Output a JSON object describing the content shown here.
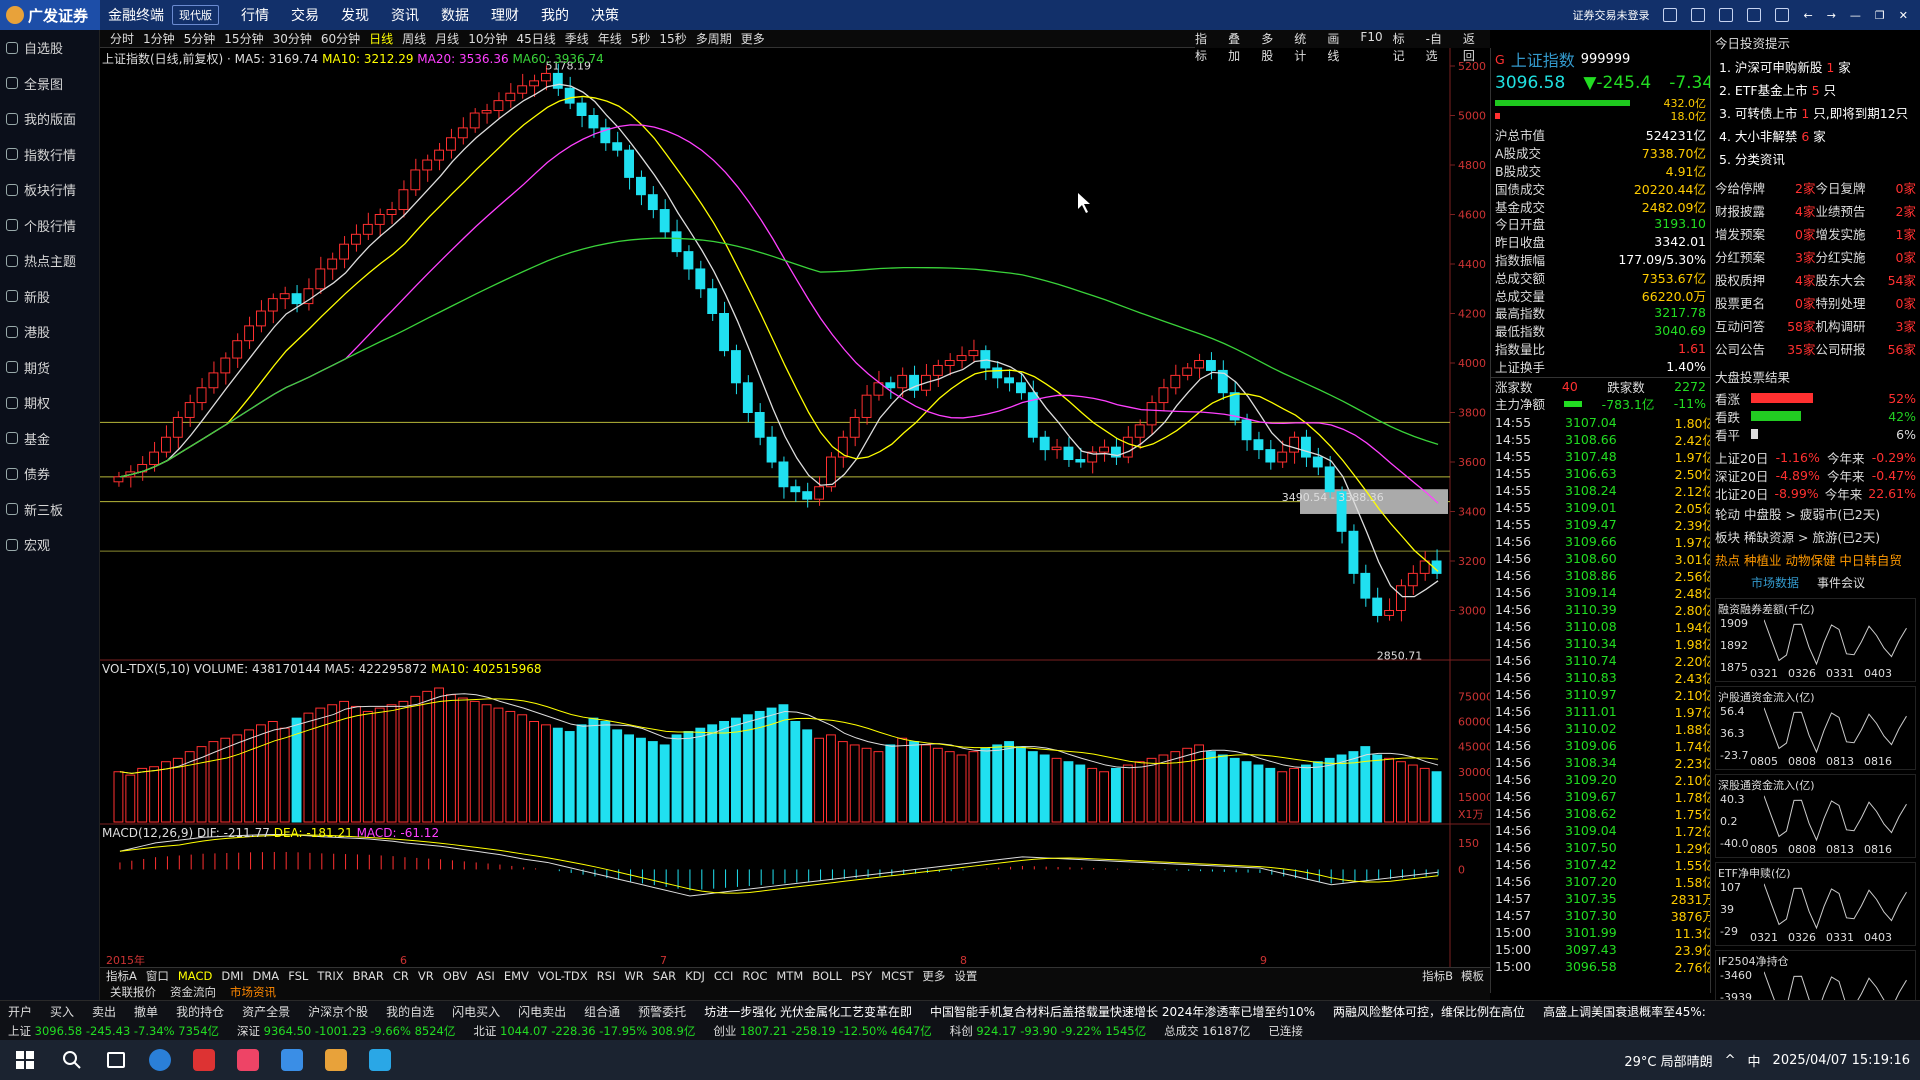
{
  "app": {
    "brand": "广发证券",
    "name": "金融终端",
    "mode": "现代版",
    "menu": [
      "行情",
      "交易",
      "发现",
      "资讯",
      "数据",
      "理财",
      "我的",
      "决策"
    ],
    "login_status": "证券交易未登录"
  },
  "sidebar": [
    "自选股",
    "全景图",
    "我的版面",
    "指数行情",
    "板块行情",
    "个股行情",
    "热点主题",
    "新股",
    "港股",
    "期货",
    "期权",
    "基金",
    "债券",
    "新三板",
    "宏观"
  ],
  "timeframes": [
    "分时",
    "1分钟",
    "5分钟",
    "15分钟",
    "30分钟",
    "60分钟",
    "日线",
    "周线",
    "月线",
    "10分钟",
    "45日线",
    "季线",
    "年线",
    "5秒",
    "15秒",
    "多周期",
    "更多"
  ],
  "timeframe_selected": "日线",
  "chart_tools": [
    "指标",
    "叠加",
    "多股",
    "统计",
    "画线",
    "F10",
    "标记",
    "-自选",
    "返回"
  ],
  "main_legend": {
    "title": "上证指数(日线,前复权)",
    "ma5": "MA5: 3169.74",
    "ma10": "MA10: 3212.29",
    "ma20": "MA20: 3536.36",
    "ma60": "MA60: 3936.74"
  },
  "vol_legend": {
    "title": "VOL-TDX(5,10)",
    "volume": "VOLUME: 438170144",
    "ma5": "MA5: 422295872",
    "ma10": "MA10: 402515968"
  },
  "macd_legend": {
    "title": "MACD(12,26,9)",
    "dif": "DIF: -211.77",
    "dea": "DEA: -181.21",
    "macd": "MACD: -61.12"
  },
  "chart_data": [
    {
      "type": "candlestick",
      "title": "上证指数(日线,前复权)",
      "ylim": [
        2800,
        5200
      ],
      "yticks": [
        5200,
        5000,
        4800,
        4600,
        4400,
        4200,
        4000,
        3800,
        3600,
        3400,
        3200,
        3000
      ],
      "annotations": [
        "5178.19",
        "2850.71",
        "3490.54 - 3388.36"
      ],
      "x_labels": [
        "2015年",
        "6",
        "7",
        "8",
        "9"
      ],
      "closes": [
        3540,
        3560,
        3590,
        3640,
        3700,
        3780,
        3840,
        3900,
        3960,
        4020,
        4090,
        4150,
        4210,
        4260,
        4280,
        4240,
        4300,
        4380,
        4420,
        4480,
        4520,
        4560,
        4600,
        4620,
        4700,
        4780,
        4820,
        4860,
        4910,
        4950,
        5010,
        5020,
        5060,
        5090,
        5120,
        5140,
        5170,
        5110,
        5050,
        5000,
        4950,
        4890,
        4860,
        4750,
        4680,
        4620,
        4530,
        4450,
        4380,
        4300,
        4200,
        4050,
        3920,
        3800,
        3700,
        3600,
        3500,
        3480,
        3450,
        3500,
        3620,
        3700,
        3780,
        3870,
        3920,
        3900,
        3950,
        3890,
        3950,
        3990,
        4010,
        4030,
        4050,
        3980,
        3940,
        3920,
        3880,
        3700,
        3650,
        3660,
        3610,
        3600,
        3640,
        3660,
        3620,
        3700,
        3750,
        3840,
        3900,
        3950,
        3980,
        4010,
        3970,
        3880,
        3770,
        3690,
        3650,
        3600,
        3640,
        3700,
        3620,
        3580,
        3480,
        3320,
        3150,
        3050,
        2980,
        3000,
        3100,
        3150,
        3200,
        3150
      ],
      "ma_series": [
        {
          "name": "MA5",
          "color": "#dddddd"
        },
        {
          "name": "MA10",
          "color": "#ffff00"
        },
        {
          "name": "MA20",
          "color": "#ff40ff"
        },
        {
          "name": "MA60",
          "color": "#3ad33a"
        }
      ]
    },
    {
      "type": "bar",
      "title": "VOL-TDX(5,10)",
      "ylim": [
        0,
        80000
      ],
      "yticks": [
        75000,
        60000,
        45000,
        30000,
        15000
      ],
      "unit": "X1万",
      "values": [
        30000,
        28000,
        32000,
        33000,
        36000,
        38000,
        42000,
        45000,
        48000,
        50000,
        52000,
        55000,
        58000,
        60000,
        56000,
        62000,
        65000,
        68000,
        70000,
        72000,
        69000,
        66000,
        68000,
        70000,
        72000,
        75000,
        78000,
        80000,
        76000,
        74000,
        72000,
        70000,
        68000,
        66000,
        64000,
        60000,
        58000,
        56000,
        54000,
        58000,
        62000,
        60000,
        55000,
        52000,
        50000,
        48000,
        46000,
        52000,
        54000,
        56000,
        58000,
        60000,
        62000,
        64000,
        66000,
        68000,
        70000,
        60000,
        55000,
        50000,
        52000,
        48000,
        46000,
        44000,
        42000,
        46000,
        50000,
        48000,
        46000,
        44000,
        42000,
        40000,
        42000,
        44000,
        46000,
        48000,
        45000,
        42000,
        40000,
        38000,
        36000,
        34000,
        32000,
        30000,
        32000,
        34000,
        36000,
        38000,
        40000,
        42000,
        44000,
        46000,
        42000,
        40000,
        38000,
        36000,
        34000,
        32000,
        30000,
        32000,
        34000,
        36000,
        38000,
        40000,
        42000,
        45000,
        40000,
        38000,
        36000,
        34000,
        32000,
        30000
      ]
    },
    {
      "type": "bar",
      "title": "MACD(12,26,9)",
      "ylim": [
        -450,
        180
      ],
      "yticks": [
        150,
        0.0
      ],
      "values": [
        40,
        50,
        60,
        70,
        75,
        80,
        85,
        90,
        92,
        94,
        96,
        98,
        99,
        100,
        100,
        98,
        95,
        92,
        90,
        88,
        86,
        84,
        80,
        76,
        70,
        66,
        62,
        58,
        52,
        46,
        40,
        34,
        28,
        20,
        12,
        6,
        0,
        -10,
        -20,
        -30,
        -40,
        -50,
        -60,
        -70,
        -80,
        -90,
        -100,
        -110,
        -120,
        -115,
        -110,
        -105,
        -100,
        -95,
        -90,
        -85,
        -80,
        -75,
        -70,
        -65,
        -60,
        -55,
        -50,
        -45,
        -40,
        -35,
        -30,
        -25,
        -20,
        -15,
        -10,
        -5,
        0,
        5,
        10,
        15,
        20,
        18,
        16,
        14,
        12,
        10,
        8,
        6,
        4,
        2,
        0,
        -2,
        -4,
        -6,
        -8,
        -10,
        -12,
        -14,
        -16,
        -18,
        -20,
        -30,
        -40,
        -50,
        -60,
        -70,
        -80,
        -75,
        -70,
        -65,
        -60,
        -55,
        -50,
        -45,
        -40,
        -35
      ]
    }
  ],
  "quote": {
    "name": "上证指数",
    "code": "999999",
    "price": "3096.58",
    "change": "▼-245.4",
    "pct": "-7.34%",
    "bar1": "432.0亿",
    "bar2": "18.0亿"
  },
  "stats": [
    {
      "k": "沪总市值",
      "v": "524231亿",
      "c": "w"
    },
    {
      "k": "A股成交",
      "v": "7338.70亿",
      "c": "y"
    },
    {
      "k": "B股成交",
      "v": "4.91亿",
      "c": "y"
    },
    {
      "k": "国债成交",
      "v": "20220.44亿",
      "c": "y"
    },
    {
      "k": "基金成交",
      "v": "2482.09亿",
      "c": "y"
    },
    {
      "k": "今日开盘",
      "v": "3193.10",
      "c": "g"
    },
    {
      "k": "昨日收盘",
      "v": "3342.01",
      "c": "w"
    },
    {
      "k": "指数振幅",
      "v": "177.09/5.30%",
      "c": "w"
    },
    {
      "k": "总成交额",
      "v": "7353.67亿",
      "c": "y"
    },
    {
      "k": "总成交量",
      "v": "66220.0万",
      "c": "y"
    },
    {
      "k": "最高指数",
      "v": "3217.78",
      "c": "g"
    },
    {
      "k": "最低指数",
      "v": "3040.69",
      "c": "g"
    },
    {
      "k": "指数量比",
      "v": "1.61",
      "c": "r"
    },
    {
      "k": "上证换手",
      "v": "1.40%",
      "c": "w"
    }
  ],
  "breadth": {
    "up_label": "涨家数",
    "up": "40",
    "down_label": "跌家数",
    "down": "2272",
    "main_label": "主力净额",
    "main_value": "-783.1亿",
    "main_pct": "-11%"
  },
  "ticks": [
    [
      "14:55",
      "3107.04",
      "1.80亿"
    ],
    [
      "14:55",
      "3108.66",
      "2.42亿"
    ],
    [
      "14:55",
      "3107.48",
      "1.97亿"
    ],
    [
      "14:55",
      "3106.63",
      "2.50亿"
    ],
    [
      "14:55",
      "3108.24",
      "2.12亿"
    ],
    [
      "14:55",
      "3109.01",
      "2.05亿"
    ],
    [
      "14:55",
      "3109.47",
      "2.39亿"
    ],
    [
      "14:56",
      "3109.66",
      "1.97亿"
    ],
    [
      "14:56",
      "3108.60",
      "3.01亿"
    ],
    [
      "14:56",
      "3108.86",
      "2.56亿"
    ],
    [
      "14:56",
      "3109.14",
      "2.48亿"
    ],
    [
      "14:56",
      "3110.39",
      "2.80亿"
    ],
    [
      "14:56",
      "3110.08",
      "1.94亿"
    ],
    [
      "14:56",
      "3110.34",
      "1.98亿"
    ],
    [
      "14:56",
      "3110.74",
      "2.20亿"
    ],
    [
      "14:56",
      "3110.83",
      "2.43亿"
    ],
    [
      "14:56",
      "3110.97",
      "2.10亿"
    ],
    [
      "14:56",
      "3111.01",
      "1.97亿"
    ],
    [
      "14:56",
      "3110.02",
      "1.88亿"
    ],
    [
      "14:56",
      "3109.06",
      "1.74亿"
    ],
    [
      "14:56",
      "3108.34",
      "2.23亿"
    ],
    [
      "14:56",
      "3109.20",
      "2.10亿"
    ],
    [
      "14:56",
      "3109.67",
      "1.78亿"
    ],
    [
      "14:56",
      "3108.62",
      "1.75亿"
    ],
    [
      "14:56",
      "3109.04",
      "1.72亿"
    ],
    [
      "14:56",
      "3107.50",
      "1.29亿"
    ],
    [
      "14:56",
      "3107.42",
      "1.55亿"
    ],
    [
      "14:56",
      "3107.20",
      "1.58亿"
    ],
    [
      "14:57",
      "3107.35",
      "2831万"
    ],
    [
      "14:57",
      "3107.30",
      "3876万"
    ],
    [
      "15:00",
      "3101.99",
      "11.3亿"
    ],
    [
      "15:00",
      "3097.43",
      "23.9亿"
    ],
    [
      "15:00",
      "3096.58",
      "2.76亿"
    ]
  ],
  "tips": {
    "title": "今日投资提示",
    "items": [
      {
        "text": "1. 沪深可申购新股",
        "n": "1",
        "unit": "家"
      },
      {
        "text": "2. ETF基金上市",
        "n": "5",
        "unit": "只"
      },
      {
        "text": "3. 可转债上市",
        "n": "1",
        "unit": "只,即将到期12只"
      },
      {
        "text": "4. 大小非解禁",
        "n": "6",
        "unit": "家"
      },
      {
        "text": "5. 分类资讯",
        "n": "",
        "unit": ""
      }
    ],
    "grid": [
      [
        "今给停牌",
        "2家",
        "今日复牌",
        "0家"
      ],
      [
        "财报披露",
        "4家",
        "业绩预告",
        "2家"
      ],
      [
        "增发预案",
        "0家",
        "增发实施",
        "1家"
      ],
      [
        "分红预案",
        "3家",
        "分红实施",
        "0家"
      ],
      [
        "股权质押",
        "4家",
        "股东大会",
        "54家"
      ],
      [
        "股票更名",
        "0家",
        "特别处理",
        "0家"
      ],
      [
        "互动问答",
        "58家",
        "机构调研",
        "3家"
      ],
      [
        "公司公告",
        "35家",
        "公司研报",
        "56家"
      ]
    ],
    "vote_title": "大盘投票结果",
    "votes": [
      {
        "lbl": "看涨",
        "pct": "52%",
        "color": "#ff3030",
        "frac": 0.52
      },
      {
        "lbl": "看跌",
        "pct": "42%",
        "color": "#22cc22",
        "frac": 0.42
      },
      {
        "lbl": "看平",
        "pct": "6%",
        "color": "#dddddd",
        "frac": 0.06
      }
    ],
    "idx": [
      [
        "上证20日",
        "-1.16%",
        "今年来",
        "-0.29%"
      ],
      [
        "深证20日",
        "-4.89%",
        "今年来",
        "-0.47%"
      ],
      [
        "北证20日",
        "-8.99%",
        "今年来",
        "22.61%"
      ]
    ],
    "rotation": "轮动 中盘股 > 疲弱市(已2天)",
    "sector": "板块 稀缺资源 > 旅游(已2天)",
    "hot": "热点 种植业 动物保健 中日韩自贸",
    "tab_market": "市场数据",
    "tab_event": "事件会议",
    "mini1": {
      "label": "融资融券差额(千亿)",
      "y": [
        "1909",
        "1892",
        "1875"
      ],
      "x": [
        "0321",
        "0326",
        "0331",
        "0403"
      ]
    },
    "mini2": {
      "label": "沪股通资金流入(亿)",
      "y": [
        "56.4",
        "36.3",
        "-23.7"
      ],
      "x": [
        "0805",
        "0808",
        "0813",
        "0816"
      ]
    },
    "mini3": {
      "label": "深股通资金流入(亿)",
      "y": [
        "40.3",
        "0.2",
        "-40.0"
      ],
      "x": [
        "0805",
        "0808",
        "0813",
        "0816"
      ]
    },
    "mini4": {
      "label": "ETF净申赎(亿)",
      "y": [
        "107",
        "39",
        "-29"
      ],
      "x": [
        "0321",
        "0326",
        "0331",
        "0403"
      ]
    },
    "mini5": {
      "label": "IF2504净持仓",
      "y": [
        "-3460",
        "-3939"
      ],
      "x": []
    }
  },
  "indicators": [
    "指标A",
    "窗口",
    "MACD",
    "DMI",
    "DMA",
    "FSL",
    "TRIX",
    "BRAR",
    "CR",
    "VR",
    "OBV",
    "ASI",
    "EMV",
    "VOL-TDX",
    "RSI",
    "WR",
    "SAR",
    "KDJ",
    "CCI",
    "ROC",
    "MTM",
    "BOLL",
    "PSY",
    "MCST",
    "更多",
    "设置"
  ],
  "indicator_selected": "MACD",
  "subtabs": [
    "关联报价",
    "资金流向",
    "市场资讯"
  ],
  "subtab_selected": "市场资讯",
  "ind_right": [
    "指标B",
    "模板"
  ],
  "function_bar": [
    "开户",
    "买入",
    "卖出",
    "撤单",
    "我的持仓",
    "资产全景",
    "沪深京个股",
    "我的自选",
    "闪电买入",
    "闪电卖出",
    "组合通",
    "预警委托"
  ],
  "news": [
    "坊进一步强化 光伏金属化工艺变革在即",
    "中国智能手机复合材料后盖搭载量快速增长 2024年渗透率已增至约10%",
    "两融风险整体可控，维保比例在高位",
    "高盛上调美国衰退概率至45%:"
  ],
  "status": [
    {
      "k": "上证",
      "v": "3096.58 -245.43 -7.34% 7354亿"
    },
    {
      "k": "深证",
      "v": "9364.50 -1001.23 -9.66% 8524亿"
    },
    {
      "k": "北证",
      "v": "1044.07 -228.36 -17.95% 308.9亿"
    },
    {
      "k": "创业",
      "v": "1807.21 -258.19 -12.50% 4647亿"
    },
    {
      "k": "科创",
      "v": "924.17 -93.90 -9.22% 1545亿"
    },
    {
      "k": "总成交",
      "v": "16187亿"
    },
    {
      "k": "",
      "v": "已连接"
    }
  ],
  "taskbar": {
    "weather": "29°C 局部晴朗",
    "ime": "中",
    "datetime": "2025/04/07 15:19:16"
  }
}
